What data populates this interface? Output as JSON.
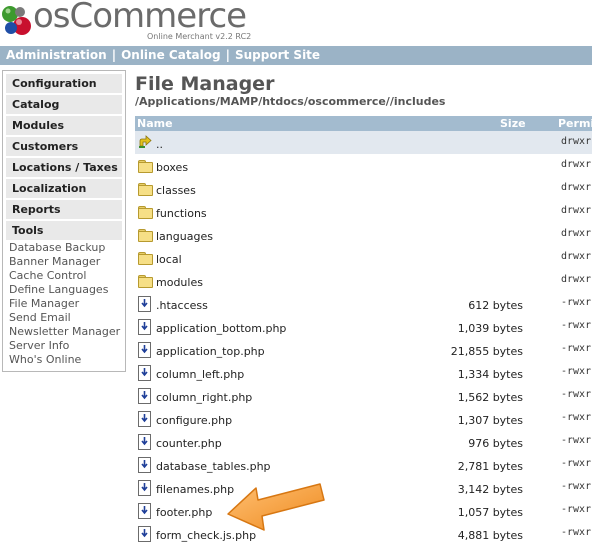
{
  "header": {
    "logo_text": "osCommerce",
    "logo_sub": "Online Merchant v2.2 RC2"
  },
  "topnav": {
    "items": [
      "Administration",
      "Online Catalog",
      "Support Site"
    ]
  },
  "sidebar": {
    "sections": [
      "Configuration",
      "Catalog",
      "Modules",
      "Customers",
      "Locations / Taxes",
      "Localization",
      "Reports",
      "Tools"
    ],
    "tools": [
      "Database Backup",
      "Banner Manager",
      "Cache Control",
      "Define Languages",
      "File Manager",
      "Send Email",
      "Newsletter Manager",
      "Server Info",
      "Who's Online"
    ]
  },
  "main": {
    "title": "File Manager",
    "path": "/Applications/MAMP/htdocs/oscommerce//includes",
    "columns": {
      "name": "Name",
      "size": "Size",
      "perm": "Permis"
    },
    "rows": [
      {
        "type": "up",
        "name": "..",
        "size": "",
        "perm": "drwxr"
      },
      {
        "type": "folder",
        "name": "boxes",
        "size": "",
        "perm": "drwxr"
      },
      {
        "type": "folder",
        "name": "classes",
        "size": "",
        "perm": "drwxr"
      },
      {
        "type": "folder",
        "name": "functions",
        "size": "",
        "perm": "drwxr"
      },
      {
        "type": "folder",
        "name": "languages",
        "size": "",
        "perm": "drwxr"
      },
      {
        "type": "folder",
        "name": "local",
        "size": "",
        "perm": "drwxr"
      },
      {
        "type": "folder",
        "name": "modules",
        "size": "",
        "perm": "drwxr"
      },
      {
        "type": "file",
        "name": ".htaccess",
        "size": "612 bytes",
        "perm": "-rwxr"
      },
      {
        "type": "file",
        "name": "application_bottom.php",
        "size": "1,039 bytes",
        "perm": "-rwxr"
      },
      {
        "type": "file",
        "name": "application_top.php",
        "size": "21,855 bytes",
        "perm": "-rwxr"
      },
      {
        "type": "file",
        "name": "column_left.php",
        "size": "1,334 bytes",
        "perm": "-rwxr"
      },
      {
        "type": "file",
        "name": "column_right.php",
        "size": "1,562 bytes",
        "perm": "-rwxr"
      },
      {
        "type": "file",
        "name": "configure.php",
        "size": "1,307 bytes",
        "perm": "-rwxr"
      },
      {
        "type": "file",
        "name": "counter.php",
        "size": "976 bytes",
        "perm": "-rwxr"
      },
      {
        "type": "file",
        "name": "database_tables.php",
        "size": "2,781 bytes",
        "perm": "-rwxr"
      },
      {
        "type": "file",
        "name": "filenames.php",
        "size": "3,142 bytes",
        "perm": "-rwxr"
      },
      {
        "type": "file",
        "name": "footer.php",
        "size": "1,057 bytes",
        "perm": "-rwxr"
      },
      {
        "type": "file",
        "name": "form_check.js.php",
        "size": "4,881 bytes",
        "perm": "-rwxr"
      }
    ]
  },
  "colors": {
    "topnav_bg": "#9bb3c6",
    "table_header_bg": "#a3bbcf",
    "selected_row_bg": "#e2e8ef",
    "sidebar_item_bg": "#e9e9e9",
    "arrow_orange": "#f39a2e"
  }
}
